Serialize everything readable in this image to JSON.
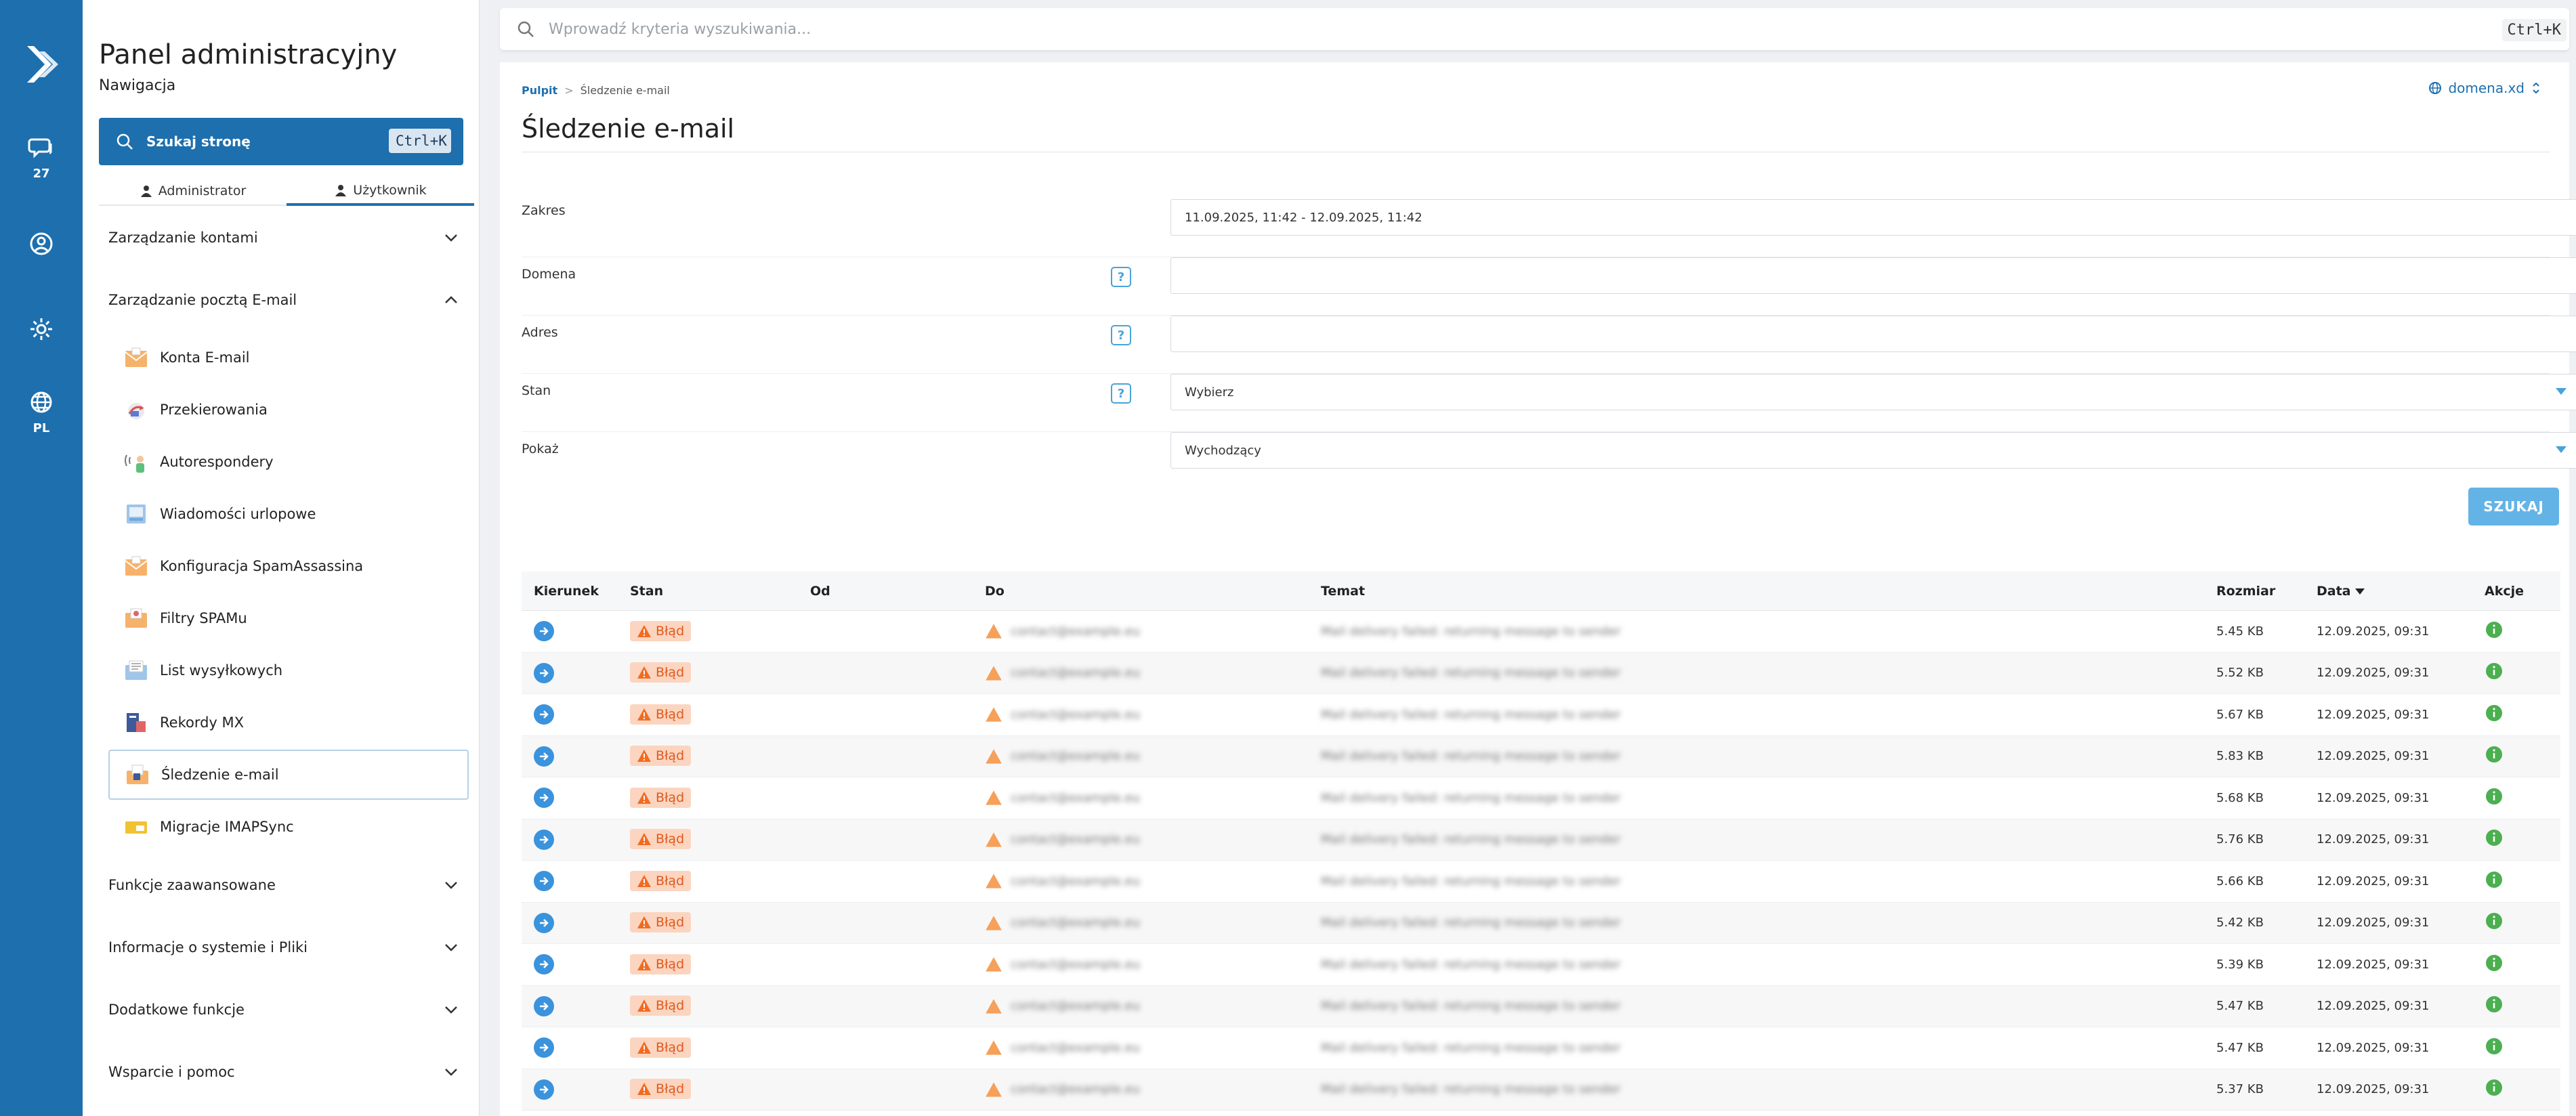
{
  "rail": {
    "chat_count": "27",
    "language": "PL"
  },
  "nav": {
    "title": "Panel administracyjny",
    "subtitle": "Nawigacja",
    "search_label": "Szukaj stronę",
    "search_shortcut": "Ctrl+K",
    "tabs": [
      {
        "label": "Administrator"
      },
      {
        "label": "Użytkownik"
      }
    ],
    "sections": [
      {
        "label": "Zarządzanie kontami"
      },
      {
        "label": "Zarządzanie pocztą E-mail"
      },
      {
        "label": "Funkcje zaawansowane"
      },
      {
        "label": "Informacje o systemie i Pliki"
      },
      {
        "label": "Dodatkowe funkcje"
      },
      {
        "label": "Wsparcie i pomoc"
      }
    ],
    "items": [
      {
        "label": "Konta E-mail"
      },
      {
        "label": "Przekierowania"
      },
      {
        "label": "Autorespondery"
      },
      {
        "label": "Wiadomości urlopowe"
      },
      {
        "label": "Konfiguracja SpamAssassina"
      },
      {
        "label": "Filtry SPAMu"
      },
      {
        "label": "List wysyłkowych"
      },
      {
        "label": "Rekordy MX"
      },
      {
        "label": "Śledzenie e-mail"
      },
      {
        "label": "Migracje IMAPSync"
      }
    ]
  },
  "topbar": {
    "placeholder": "Wprowadź kryteria wyszukiwania...",
    "shortcut": "Ctrl+K"
  },
  "main": {
    "breadcrumb_home": "Pulpit",
    "breadcrumb_sep": ">",
    "breadcrumb_current": "Śledzenie e-mail",
    "domain": "domena.xd",
    "title": "Śledzenie e-mail",
    "form": {
      "range_label": "Zakres",
      "range_value": "11.09.2025, 11:42 - 12.09.2025, 11:42",
      "domain_label": "Domena",
      "address_label": "Adres",
      "state_label": "Stan",
      "state_value": "Wybierz",
      "show_label": "Pokaż",
      "show_value": "Wychodzący",
      "help": "?"
    },
    "search_button": "SZUKAJ",
    "table": {
      "headers": {
        "direction": "Kierunek",
        "state": "Stan",
        "from": "Od",
        "to": "Do",
        "subject": "Temat",
        "size": "Rozmiar",
        "date": "Data",
        "actions": "Akcje"
      },
      "status_label": "Błąd",
      "blurred_to": "contact@example.eu",
      "blurred_subject": "Mail delivery failed: returning message to sender",
      "rows": [
        {
          "size": "5.45 KB",
          "date": "12.09.2025, 09:31"
        },
        {
          "size": "5.52 KB",
          "date": "12.09.2025, 09:31"
        },
        {
          "size": "5.67 KB",
          "date": "12.09.2025, 09:31"
        },
        {
          "size": "5.83 KB",
          "date": "12.09.2025, 09:31"
        },
        {
          "size": "5.68 KB",
          "date": "12.09.2025, 09:31"
        },
        {
          "size": "5.76 KB",
          "date": "12.09.2025, 09:31"
        },
        {
          "size": "5.66 KB",
          "date": "12.09.2025, 09:31"
        },
        {
          "size": "5.42 KB",
          "date": "12.09.2025, 09:31"
        },
        {
          "size": "5.39 KB",
          "date": "12.09.2025, 09:31"
        },
        {
          "size": "5.47 KB",
          "date": "12.09.2025, 09:31"
        },
        {
          "size": "5.47 KB",
          "date": "12.09.2025, 09:31"
        },
        {
          "size": "5.37 KB",
          "date": "12.09.2025, 09:31"
        }
      ]
    }
  },
  "colors": {
    "brand": "#1d6fae",
    "error_bg": "#fbd5c0",
    "error_fg": "#e1591d",
    "action": "#4caf50"
  }
}
